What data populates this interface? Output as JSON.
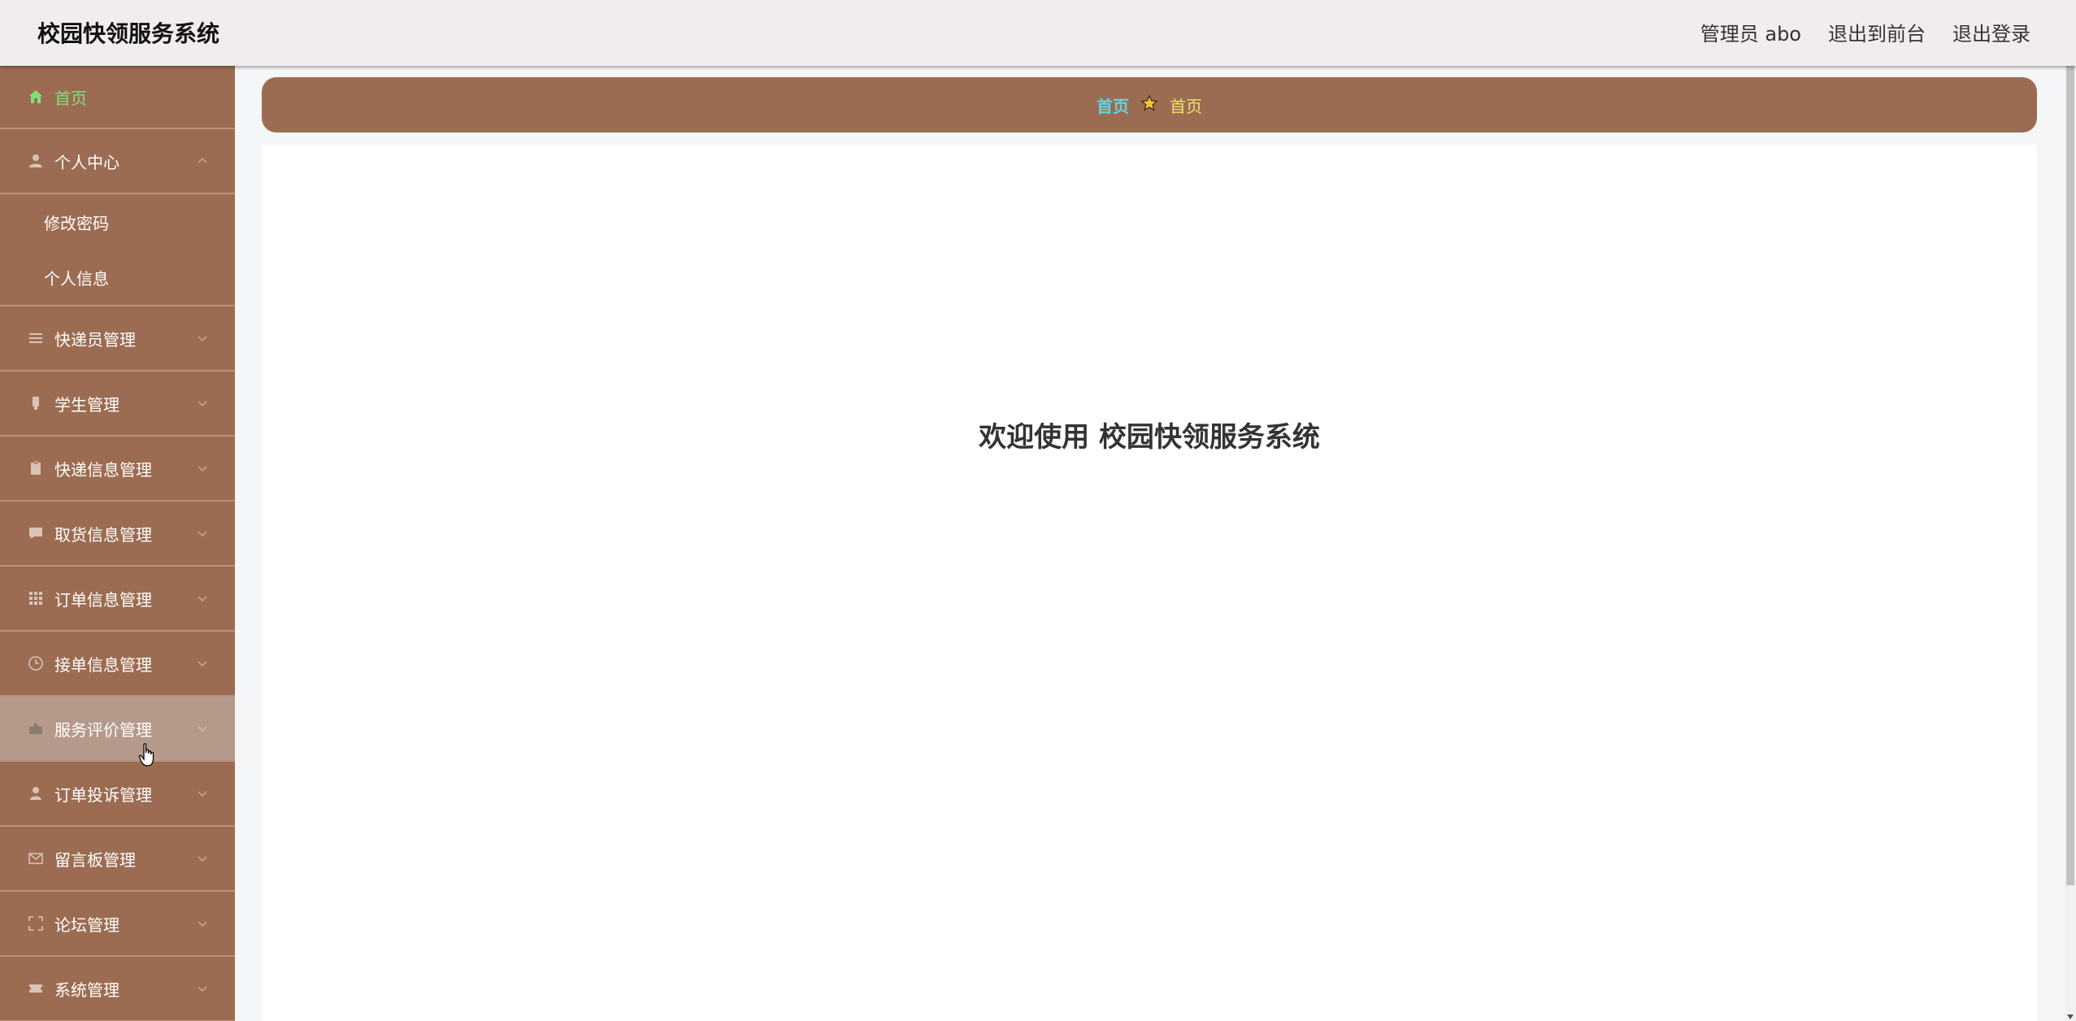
{
  "header": {
    "app_title": "校园快领服务系统",
    "admin_label": "管理员 abo",
    "to_front_label": "退出到前台",
    "logout_label": "退出登录"
  },
  "sidebar": {
    "items": [
      {
        "label": "首页",
        "icon": "home-icon"
      },
      {
        "label": "个人中心",
        "icon": "user-icon",
        "expanded": true,
        "children": [
          {
            "label": "修改密码"
          },
          {
            "label": "个人信息"
          }
        ]
      },
      {
        "label": "快递员管理",
        "icon": "menu-lines-icon"
      },
      {
        "label": "学生管理",
        "icon": "student-icon"
      },
      {
        "label": "快递信息管理",
        "icon": "clipboard-icon"
      },
      {
        "label": "取货信息管理",
        "icon": "chat-icon"
      },
      {
        "label": "订单信息管理",
        "icon": "grid-icon"
      },
      {
        "label": "接单信息管理",
        "icon": "clock-icon"
      },
      {
        "label": "服务评价管理",
        "icon": "rating-icon",
        "hovered": true
      },
      {
        "label": "订单投诉管理",
        "icon": "person-icon"
      },
      {
        "label": "留言板管理",
        "icon": "mail-icon"
      },
      {
        "label": "论坛管理",
        "icon": "fullscreen-icon"
      },
      {
        "label": "系统管理",
        "icon": "ticket-icon"
      }
    ]
  },
  "breadcrumb": {
    "first": "首页",
    "separator_icon": "star-icon",
    "second": "首页"
  },
  "main": {
    "welcome_text": "欢迎使用 校园快领服务系统"
  },
  "colors": {
    "sidebar_bg": "#9c6c52",
    "topbar_bg": "#f2eded",
    "active_menu_text": "#7fe07a",
    "crumb_link": "#5fd4e2",
    "crumb_current": "#f0e06a"
  }
}
